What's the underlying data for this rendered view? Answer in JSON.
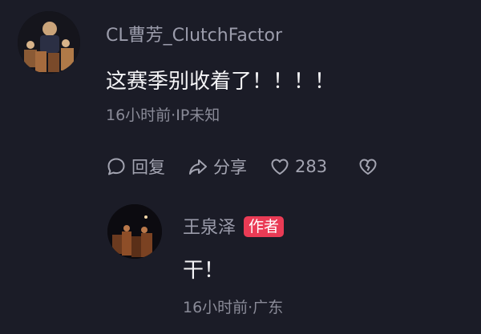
{
  "comment": {
    "username": "CL曹芳_ClutchFactor",
    "text": "这赛季别收着了！！！！",
    "meta": "16小时前·IP未知",
    "actions": {
      "reply_label": "回复",
      "share_label": "分享",
      "like_count": "283"
    },
    "icons": [
      "reply-icon",
      "share-icon",
      "heart-icon",
      "broken-heart-icon"
    ]
  },
  "reply": {
    "username": "王泉泽",
    "badge": "作者",
    "text": "干！",
    "meta": "16小时前·广东"
  },
  "colors": {
    "background": "#1b1c27",
    "badge": "#ea3b55",
    "username": "#9b9cab",
    "meta": "#8a8b98"
  }
}
